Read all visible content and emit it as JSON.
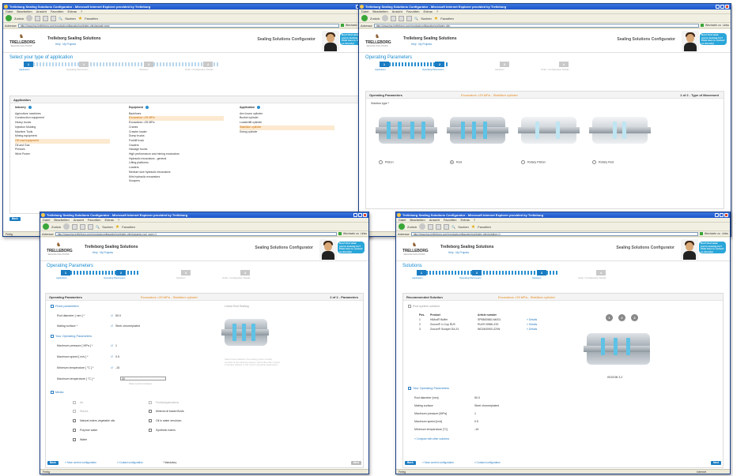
{
  "browser": {
    "title": "Trelleborg Sealing Solutions Configurator - Microsoft Internet Explorer provided by Trelleborg",
    "menu": [
      "Datei",
      "Bearbeiten",
      "Ansicht",
      "Favoriten",
      "Extras",
      "?"
    ],
    "back_label": "Zurück",
    "search_label": "Suchen",
    "favorites_label": "Favoriten",
    "address_label": "Adresse",
    "url_1": "http://www.tss.trelleborg.com/productconfigurator/pg/index.cfm/appsel=new",
    "url_2": "http://www.tss.trelleborg.com/productconfigurator/pg/index.cfm",
    "url_3": "http://www.tss.trelleborg.com/productconfigurator/pg/index.cfm/params=rod_oper=1",
    "url_4": "http://www.tss.trelleborg.com/productconfigurator/pg/index.cfm/solution=1",
    "go_label": "Wechseln zu",
    "links_label": "Links",
    "status_done": "Fertig",
    "status_zone": "Internet",
    "status_url": "http://www.tss.trelleborg.com"
  },
  "header": {
    "logo_text": "TRELLEBORG",
    "logo_sub": "SEALING SOLUTIONS",
    "brand": "Trelleborg Sealing Solutions",
    "help_links": "Help · My Projects",
    "configurator": "Sealing Solutions Configurator",
    "bubble": "Don't find what you're looking for? Click here to contact us directly!"
  },
  "steps": {
    "labels": [
      "Application",
      "Operating Parameters",
      "Solutions",
      "Order / Configuration Details"
    ],
    "numbers": [
      "1",
      "2",
      "3",
      "4"
    ]
  },
  "win1": {
    "title": "Select your type of application",
    "panel_head": "Application",
    "industry_head": "Industry",
    "industry": [
      "Agriculture machines",
      "Construction equipment",
      "Heavy trucks",
      "Injection Molding",
      "Machine Tools",
      "Mining equipment",
      "Off road equipment",
      "Oil and Gas",
      "Presses",
      "Wind Power"
    ],
    "industry_sel": 6,
    "equipment_head": "Equipment",
    "equipment": [
      "Backhoes",
      "Excavators <25 MPa",
      "Excavators >25 MPa",
      "Cranes",
      "Crawler loader",
      "Dump trucks",
      "Forklift truck",
      "Graders",
      "Haulage trucks",
      "High performance and mining excavators",
      "Hydraulic excavators - general",
      "Lifting platforms",
      "Loaders",
      "Medium size hydraulic excavators",
      "Mini hydraulic excavators",
      "Scrapers"
    ],
    "equipment_sel": 1,
    "application_head": "Application",
    "application": [
      "Arm boom cylinder",
      "Bucket cylinder",
      "Loader/lift cylinder",
      "Stabilizer cylinder",
      "Swing cylinder"
    ],
    "application_sel": 3,
    "back_button": "Back"
  },
  "win2": {
    "title": "Operating Parameters",
    "panel_head": "Operating Parameters",
    "panel_sub": "Excavators <25 MPa - Stabilizer cylinder",
    "panel_right": "1 of 2 - Type of Movement",
    "solution_type_label": "Solution type *",
    "options": [
      "Piston",
      "Rod",
      "Rotary Piston",
      "Rotary Rod"
    ],
    "selected_option": 1
  },
  "win3": {
    "title": "Operating Parameters",
    "panel_head": "Operating Parameters",
    "panel_sub": "Excavators <25 MPa - Stabilizer cylinder",
    "panel_right": "2 of 2 - Parameters",
    "section_fixed": "Fixed parameters",
    "rod_label": "Rod diameter [ mm ] *",
    "rod_value": "50.0",
    "mating_label": "Mating surface *",
    "mating_value": "Steel chromeplated",
    "section_operating": "Your Operating Parameters",
    "pressure_label": "Maximum pressure [ MPa ] *",
    "pressure_value": "1",
    "speed_label": "Maximum speed [ m/s ] *",
    "speed_value": "0.5",
    "min_temp_label": "Minimum temperature [ °C ] *",
    "min_temp_value": "-15",
    "max_temp_label": "Maximum temperature [ °C ] *",
    "max_temp_value": "30",
    "max_temp_hint": "Value must be between",
    "section_media": "Media",
    "media": [
      "Air",
      "Stacks",
      "Natural esters vegetable oils",
      "Polymer water",
      "Water"
    ],
    "media_right": [
      "Fluids/Applications",
      "Mineral oil based fluids",
      "Oil in water emulsion",
      "Synthetic esters"
    ],
    "linear_title": "Linear Rod Sealing",
    "notes": "Select these defaults, the sealing system usually consists of the following options. Add further filter criteria if needed, defined to the current operating parameters.",
    "back_button": "Back",
    "save_link": "Save current configuration",
    "contact_link": "Contact configuration",
    "mandatory": "* Mandatory",
    "next_button": "Next"
  },
  "win4": {
    "title": "Solutions",
    "panel_head": "Recommended Solution",
    "panel_sub": "Excavators <25 MPa - Stabilizer cylinder",
    "section_solution": "Rod system solution",
    "table_headers": [
      "Pos.",
      "Product",
      "Article number",
      ""
    ],
    "table_rows": [
      [
        "1",
        "HiMod® Buffer",
        "SPB500560-N4001",
        "» Details"
      ],
      [
        "2",
        "Zurcon® U-Cup RU9",
        "RUV9 00560-Z20",
        "» Details"
      ],
      [
        "3",
        "Zurcon® Scraper DA 24",
        "WD2400500-Z20N",
        "» Details"
      ]
    ],
    "circles": [
      "1",
      "2",
      "3"
    ],
    "diagram_caption": "ISO/DIN 3.2",
    "section_params": "Your Operating Parameters",
    "param_labels": [
      "Rod diameter [mm]",
      "Mating surface",
      "Maximum pressure [MPa]",
      "Maximum speed [m/s]",
      "Minimum temperature [°C]"
    ],
    "param_values": [
      "50.0",
      "Steel chromeplated",
      "1",
      "0.5",
      "-15"
    ],
    "compare_link": "Compare with other solutions",
    "back_button": "Back",
    "save_link": "Save current configuration",
    "contact_link": "Contact configuration",
    "next_button": "Next"
  }
}
